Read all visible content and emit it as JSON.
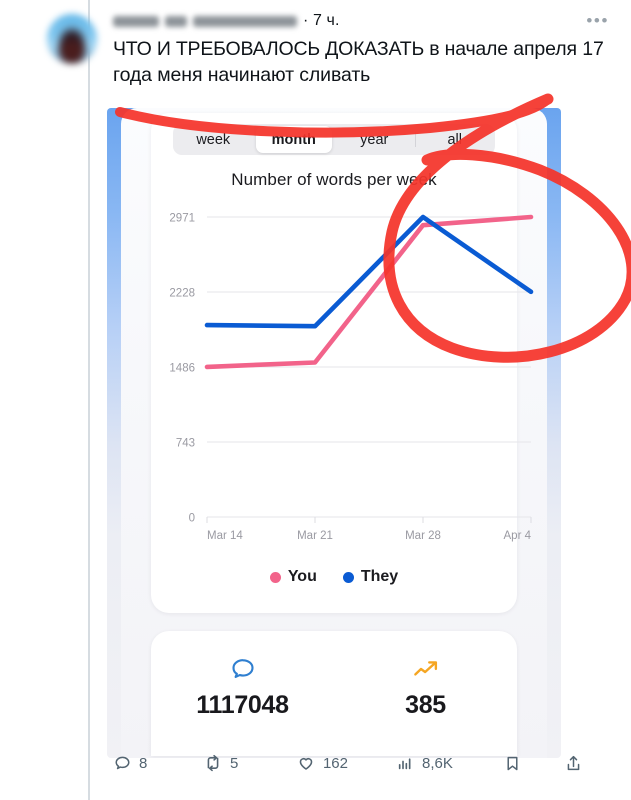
{
  "tweet": {
    "author_name_redacted": true,
    "timestamp": "· 7 ч.",
    "more_icon": "ellipsis-icon",
    "text_line1": "ЧТО И ТРЕБОВАЛОСЬ ДОКАЗАТЬ в начале",
    "text_line2": "апреля 17 года меня начинают сливать",
    "actions": [
      {
        "icon": "reply-icon",
        "count": "8"
      },
      {
        "icon": "retweet-icon",
        "count": "5"
      },
      {
        "icon": "like-icon",
        "count": "162"
      },
      {
        "icon": "views-icon",
        "count": "8,6K"
      },
      {
        "icon": "bookmark-icon",
        "count": ""
      },
      {
        "icon": "share-icon",
        "count": ""
      }
    ]
  },
  "screenshot": {
    "tabs": [
      {
        "label": "week",
        "active": false
      },
      {
        "label": "month",
        "active": true
      },
      {
        "label": "year",
        "active": false
      },
      {
        "label": "all",
        "active": false
      }
    ],
    "legend": [
      {
        "label": "You",
        "color": "#f2638a"
      },
      {
        "label": "They",
        "color": "#0a5bd3"
      }
    ],
    "stats": [
      {
        "icon": "chat-bubble-icon",
        "icon_color": "#2f7fd0",
        "value": "1117048"
      },
      {
        "icon": "trending-up-icon",
        "icon_color": "#f5a623",
        "value": "385"
      }
    ]
  },
  "annotation": {
    "marker_color": "#f5342b",
    "shape": "hand-drawn-red-ellipse"
  },
  "chart_data": {
    "type": "line",
    "title": "Number of words per week",
    "xlabel": "",
    "ylabel": "",
    "x": [
      "Mar 14",
      "Mar 21",
      "Mar 28",
      "Apr 4"
    ],
    "yticks": [
      0,
      743,
      1486,
      2228,
      2971
    ],
    "ylim": [
      0,
      2971
    ],
    "grid": true,
    "legend_position": "bottom-center",
    "series": [
      {
        "name": "You",
        "color": "#f2638a",
        "values": [
          1486,
          1530,
          2890,
          2971
        ]
      },
      {
        "name": "They",
        "color": "#0a5bd3",
        "values": [
          1900,
          1890,
          2971,
          2230
        ]
      }
    ]
  }
}
